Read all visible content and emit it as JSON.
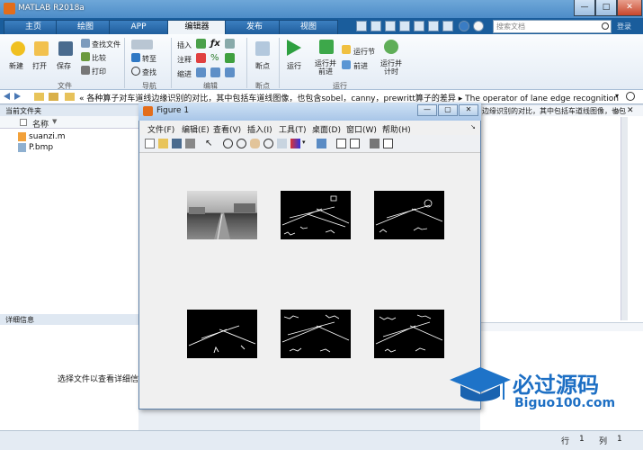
{
  "titlebar": {
    "title": "MATLAB R2018a",
    "min": "—",
    "max": "□",
    "close": "✕"
  },
  "tabs": [
    "主页",
    "绘图",
    "APP",
    "编辑器",
    "发布",
    "视图"
  ],
  "active_tab": "编辑器",
  "search": {
    "placeholder": "搜索文档"
  },
  "logout": "登录",
  "ribbon": {
    "file_group": {
      "label": "文件",
      "new": "新建",
      "open": "打开",
      "save": "保存",
      "find_files": "查找文件",
      "compare": "比较",
      "print": "打印"
    },
    "nav_group": {
      "label": "导航",
      "goto": "转至",
      "find": "查找"
    },
    "edit_group": {
      "label": "编辑",
      "insert": "插入",
      "comment": "注释",
      "indent": "缩进"
    },
    "breakpoint_group": {
      "label": "断点",
      "breakpoints": "断点"
    },
    "run_group": {
      "label": "运行",
      "run": "运行",
      "run_advance": "运行并\n前进",
      "run_section": "运行节",
      "advance": "前进",
      "run_time": "运行并\n计时"
    }
  },
  "address": {
    "path": "« 各种算子对车道线边缘识别的对比，其中包括车道线图像，也包含sobel，canny，prewritt算子的差异 ▸ The operator of lane edge recognition",
    "right_crumb": "边缘识别的对比，其中包括车道线图像，也包"
  },
  "left_panel": {
    "title": "当前文件夹",
    "column_name": "名称",
    "files": [
      {
        "name": "suanzi.m",
        "type": "m"
      },
      {
        "name": "P.bmp",
        "type": "bmp"
      }
    ],
    "details_title": "详细信息",
    "details_hint": "选择文件以查看详细信息"
  },
  "figure": {
    "title": "Figure 1",
    "menu": [
      "文件(F)",
      "编辑(E)",
      "查看(V)",
      "插入(I)",
      "工具(T)",
      "桌面(D)",
      "窗口(W)",
      "帮助(H)"
    ],
    "images": [
      {
        "name": "original-road",
        "kind": "grayscale"
      },
      {
        "name": "edge-1",
        "kind": "edges"
      },
      {
        "name": "edge-2",
        "kind": "edges"
      },
      {
        "name": "edge-3",
        "kind": "edges"
      },
      {
        "name": "edge-4",
        "kind": "edges"
      },
      {
        "name": "edge-5",
        "kind": "edges"
      }
    ]
  },
  "status": {
    "row_label": "行",
    "row": "1",
    "col_label": "列",
    "col": "1"
  },
  "watermark": {
    "brand": "必过源码",
    "url": "Biguo100.com"
  }
}
